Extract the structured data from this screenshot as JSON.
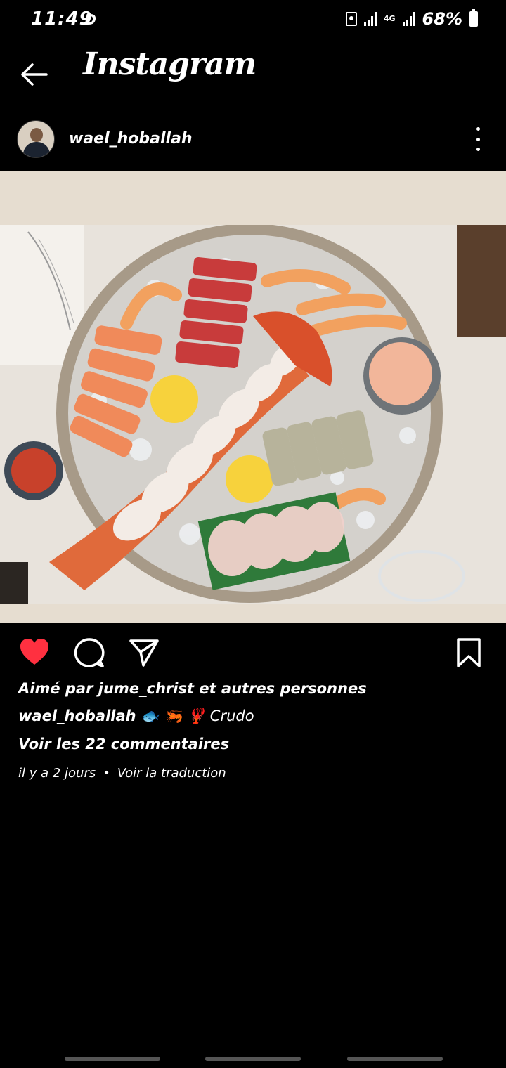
{
  "status_bar": {
    "time": "11:49",
    "left_icon_text": "Ð",
    "network_label": "4G",
    "battery_percent": "68%"
  },
  "header": {
    "title": "Instagram",
    "back_icon": "arrow-left-icon"
  },
  "post": {
    "username": "wael_hoballah",
    "likes_text": "Aimé par jume_christ et autres personnes",
    "caption_user": "wael_hoballah",
    "caption_emojis": "🐟 🦐 🦞",
    "caption_text": "Crudo",
    "comments_link": "Voir les 22 commentaires",
    "time_ago": "il y a 2 jours",
    "separator": "•",
    "translate_link": "Voir la traduction",
    "liked": true
  },
  "colors": {
    "like_red": "#ff3040",
    "background": "#000000",
    "media_bg": "#e6ddd0"
  }
}
